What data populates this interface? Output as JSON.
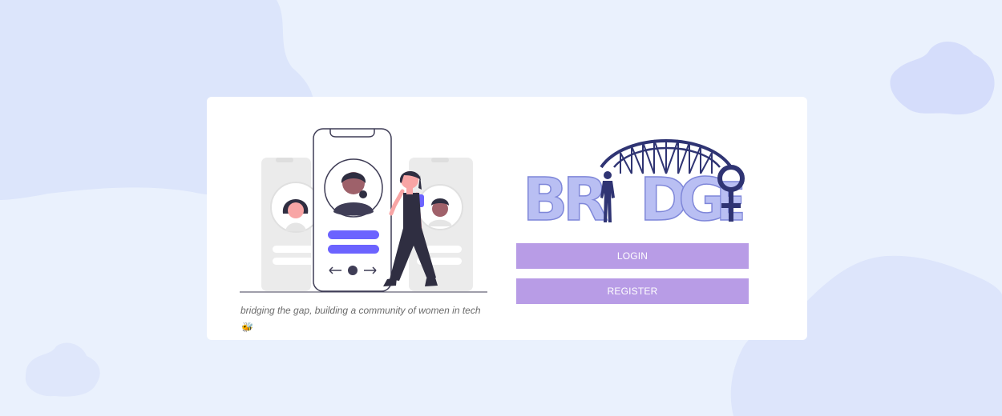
{
  "brand": {
    "logo_text": "BRIDGE",
    "colors": {
      "letters": "#b9bff3",
      "dark": "#2f3473",
      "button": "#b89ce6",
      "accent": "#6c63ff"
    }
  },
  "hero": {
    "illustration_icon": "people-matching-illustration",
    "tagline": "bridging the gap, building a community of women in tech",
    "tagline_icon": "bee-icon",
    "tagline_emoji": "🐝"
  },
  "actions": {
    "login_label": "LOGIN",
    "register_label": "REGISTER"
  }
}
